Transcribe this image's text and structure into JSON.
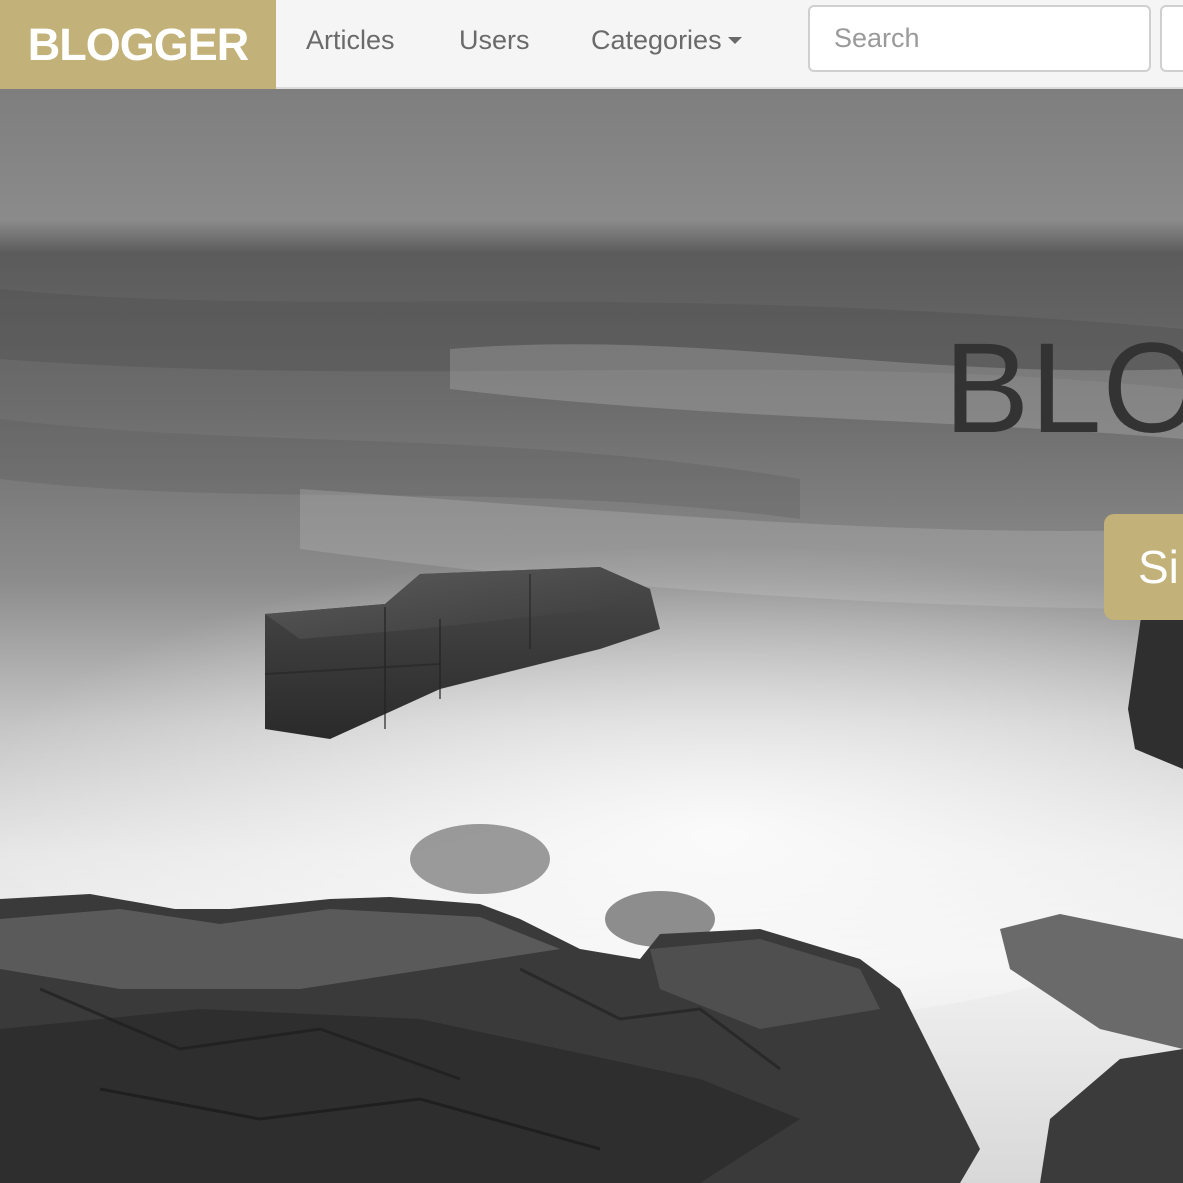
{
  "navbar": {
    "brand": "BLOGGER",
    "items": [
      {
        "label": "Articles"
      },
      {
        "label": "Users"
      },
      {
        "label": "Categories",
        "has_dropdown": true
      }
    ],
    "search": {
      "placeholder": "Search",
      "value": ""
    }
  },
  "hero": {
    "title": "BLO",
    "cta_label": "Si",
    "background": "black-and-white seascape photograph with rocks in misty water"
  },
  "colors": {
    "brand": "#c2b27a",
    "navbar_bg": "#f5f5f5",
    "nav_text": "#6a6a6a",
    "hero_title": "#333333"
  },
  "icons": [
    "caret-down-icon"
  ]
}
